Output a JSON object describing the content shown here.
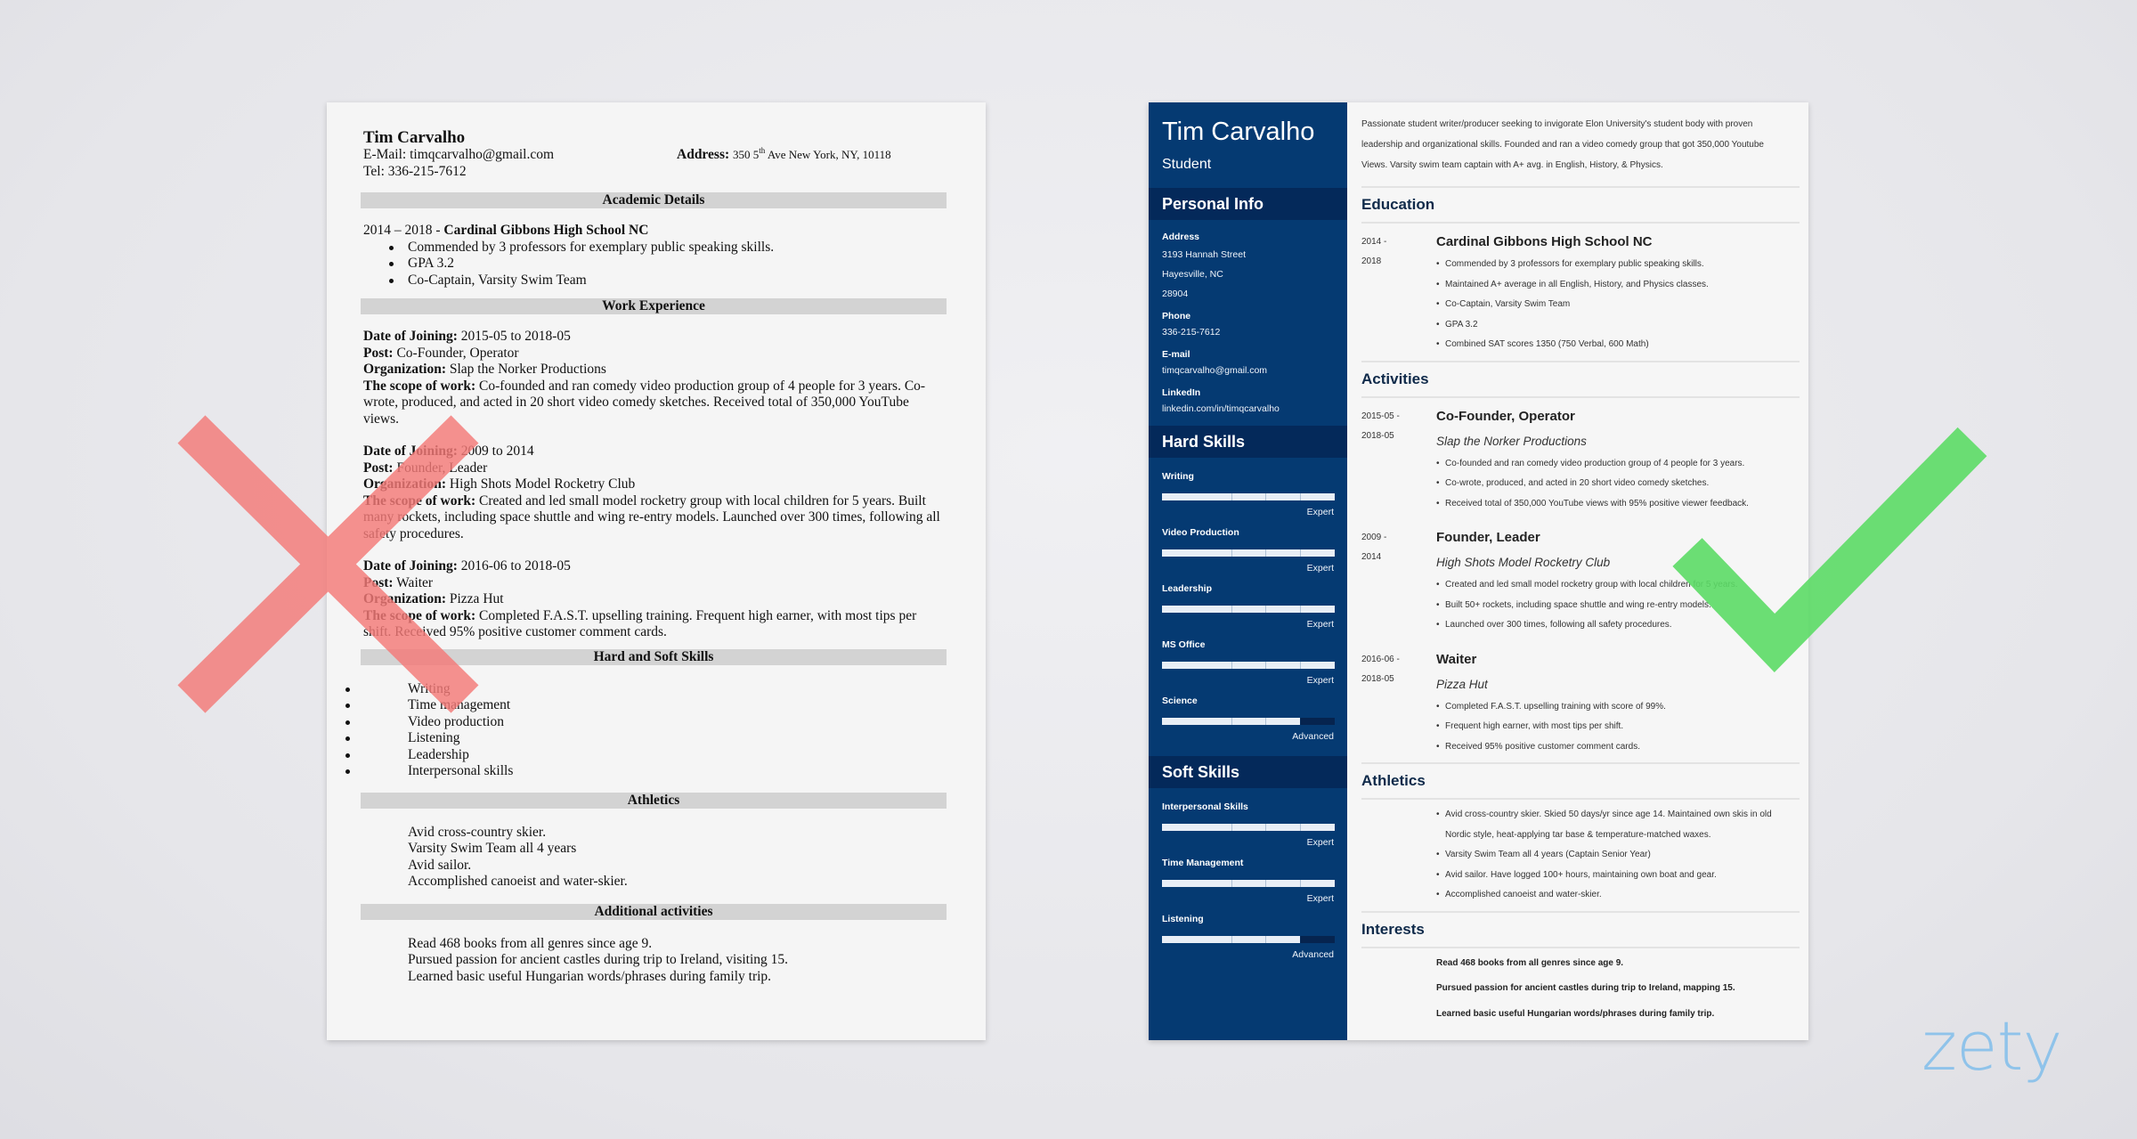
{
  "bad_resume": {
    "name": "Tim Carvalho",
    "email_label": "E-Mail:",
    "email": "timqcarvalho@gmail.com",
    "address_label": "Address:",
    "address_pre": "350 5",
    "address_sup": "th",
    "address_post": " Ave New York, NY, 10118",
    "tel_label": "Tel:",
    "tel": "336-215-7612",
    "sections": {
      "academic": "Academic Details",
      "work": "Work Experience",
      "skills": "Hard and Soft Skills",
      "athletics": "Athletics",
      "additional": "Additional activities"
    },
    "education": {
      "years": "2014 – 2018 - ",
      "school": "Cardinal Gibbons High School NC",
      "bullets": [
        "Commended by 3 professors for exemplary public speaking skills.",
        "GPA 3.2",
        "Co-Captain, Varsity Swim Team"
      ]
    },
    "labels": {
      "date": "Date of Joining:",
      "post": "Post:",
      "org": "Organization:",
      "scope": "The scope of work:"
    },
    "jobs": [
      {
        "date": " 2015-05 to 2018-05",
        "post": " Co-Founder, Operator",
        "org": " Slap the Norker Productions",
        "scope": " Co-founded and ran comedy video production group of 4 people for 3 years. Co-wrote, produced, and acted in 20 short video comedy sketches. Received total of 350,000 YouTube views."
      },
      {
        "date": " 2009 to 2014",
        "post": " Founder, Leader",
        "org": " High Shots Model Rocketry Club",
        "scope": " Created and led small model rocketry group with local children for 5 years. Built many rockets, including space shuttle and wing re-entry models. Launched over 300 times, following all safety procedures."
      },
      {
        "date": " 2016-06 to 2018-05",
        "post": " Waiter",
        "org": " Pizza Hut",
        "scope": " Completed F.A.S.T. upselling training. Frequent high earner, with most tips per shift. Received 95% positive customer comment cards."
      }
    ],
    "skills": [
      "Writing",
      "Time management",
      "Video production",
      "Listening",
      "Leadership",
      "Interpersonal skills"
    ],
    "athletics": [
      "Avid cross-country skier.",
      "Varsity Swim Team all 4 years",
      "Avid sailor.",
      "Accomplished canoeist and water-skier."
    ],
    "additional": [
      "Read 468 books from all genres since age 9.",
      "Pursued passion for ancient castles during trip to Ireland, visiting 15.",
      "Learned basic useful Hungarian words/phrases during family trip."
    ]
  },
  "good_resume": {
    "name": "Tim Carvalho",
    "title": "Student",
    "summary": "Passionate student writer/producer seeking to invigorate Elon University's student body with proven leadership and organizational skills. Founded and ran a video comedy group that got 350,000 Youtube Views. Varsity swim team captain with A+ avg. in English, History, & Physics.",
    "sidebar": {
      "personal_info_title": "Personal Info",
      "address_label": "Address",
      "address_lines": [
        "3193 Hannah Street",
        "Hayesville, NC",
        "28904"
      ],
      "phone_label": "Phone",
      "phone": "336-215-7612",
      "email_label": "E-mail",
      "email": "timqcarvalho@gmail.com",
      "linkedin_label": "LinkedIn",
      "linkedin": "linkedin.com/in/timqcarvalho",
      "hard_skills_title": "Hard Skills",
      "hard_skills": [
        {
          "name": "Writing",
          "level": "Expert",
          "fill": 1.0
        },
        {
          "name": "Video Production",
          "level": "Expert",
          "fill": 1.0
        },
        {
          "name": "Leadership",
          "level": "Expert",
          "fill": 1.0
        },
        {
          "name": "MS Office",
          "level": "Expert",
          "fill": 1.0
        },
        {
          "name": "Science",
          "level": "Advanced",
          "fill": 0.8
        }
      ],
      "soft_skills_title": "Soft Skills",
      "soft_skills": [
        {
          "name": "Interpersonal Skills",
          "level": "Expert",
          "fill": 1.0
        },
        {
          "name": "Time Management",
          "level": "Expert",
          "fill": 1.0
        },
        {
          "name": "Listening",
          "level": "Advanced",
          "fill": 0.8
        }
      ]
    },
    "education_title": "Education",
    "education": {
      "date_start": "2014 -",
      "date_end": "2018",
      "school": "Cardinal Gibbons High School NC",
      "bullets": [
        "Commended by 3 professors for exemplary public speaking skills.",
        "Maintained A+ average in all English, History, and Physics classes.",
        "Co-Captain, Varsity Swim Team",
        "GPA 3.2",
        "Combined SAT scores 1350 (750 Verbal, 600 Math)"
      ]
    },
    "activities_title": "Activities",
    "activities": [
      {
        "date_start": "2015-05 -",
        "date_end": "2018-05",
        "title": "Co-Founder, Operator",
        "org": "Slap the Norker Productions",
        "bullets": [
          "Co-founded and ran comedy video production group of 4 people for 3 years.",
          "Co-wrote, produced, and acted in 20 short video comedy sketches.",
          "Received total of 350,000 YouTube views with 95% positive viewer feedback."
        ]
      },
      {
        "date_start": "2009 -",
        "date_end": "2014",
        "title": "Founder, Leader",
        "org": "High Shots Model Rocketry Club",
        "bullets": [
          "Created and led small model rocketry group with local children for 5 years.",
          "Built 50+ rockets, including space shuttle and wing re-entry models.",
          "Launched over 300 times, following all safety procedures."
        ]
      },
      {
        "date_start": "2016-06 -",
        "date_end": "2018-05",
        "title": "Waiter",
        "org": "Pizza Hut",
        "bullets": [
          "Completed F.A.S.T. upselling training with score of 99%.",
          "Frequent high earner, with most tips per shift.",
          "Received 95% positive customer comment cards."
        ]
      }
    ],
    "athletics_title": "Athletics",
    "athletics": [
      "Avid cross-country skier. Skied 50 days/yr since age 14. Maintained own skis in old Nordic style, heat-applying tar base & temperature-matched waxes.",
      "Varsity Swim Team all 4 years (Captain Senior Year)",
      "Avid sailor. Have logged 100+ hours, maintaining own boat and gear.",
      "Accomplished canoeist and water-skier."
    ],
    "interests_title": "Interests",
    "interests": [
      "Read 468 books from all genres since age 9.",
      "Pursued passion for ancient castles during trip to Ireland, mapping 15.",
      "Learned basic useful Hungarian words/phrases during family trip."
    ]
  },
  "marks": {
    "bad_icon": "cross-mark-icon",
    "good_icon": "check-mark-icon",
    "bad_color": "#f47a78",
    "good_color": "#5cdc66",
    "sidebar_color": "#053a72",
    "sidebar_band_color": "#04295a"
  },
  "brand": {
    "logo": "zety",
    "color": "#8fc3ea"
  }
}
